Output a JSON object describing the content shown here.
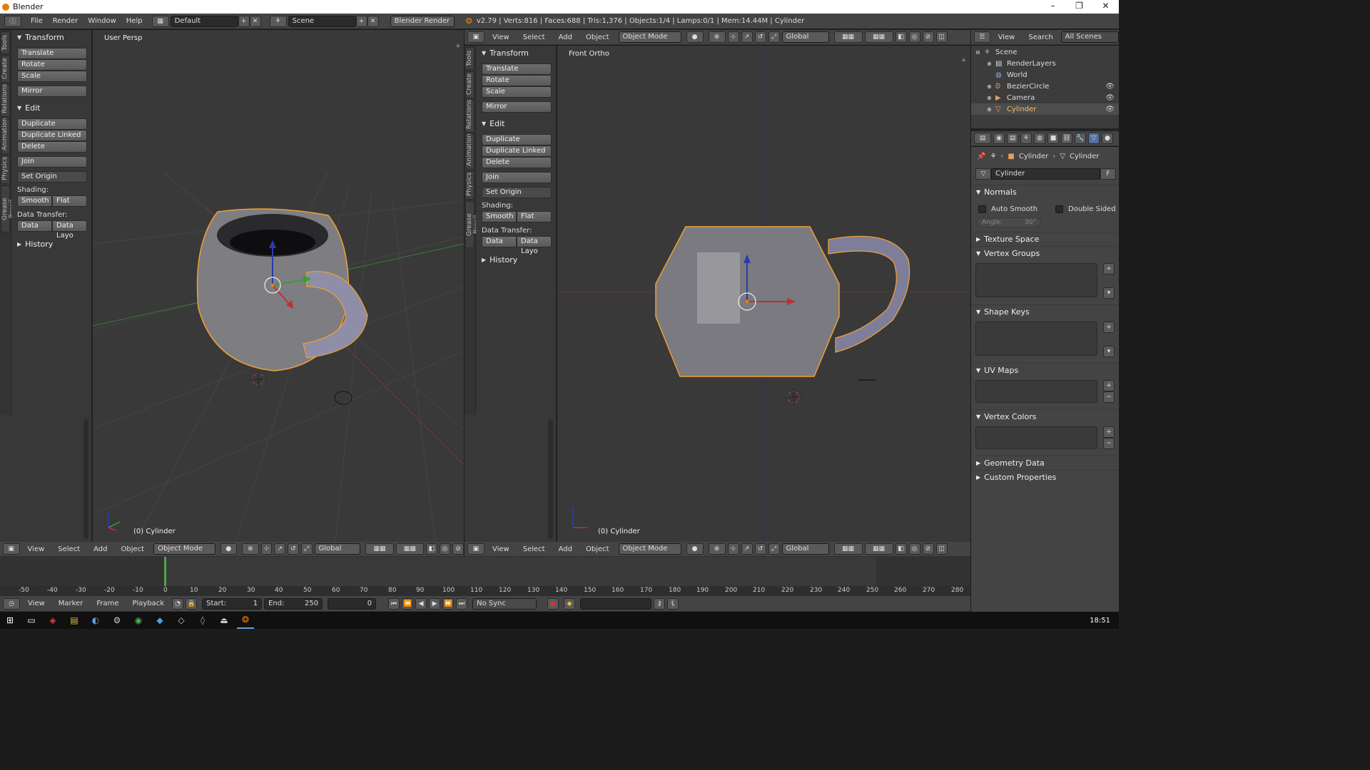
{
  "window": {
    "title": "Blender",
    "min": "–",
    "restore": "❐",
    "close": "✕"
  },
  "info": {
    "menus": [
      "File",
      "Render",
      "Window",
      "Help"
    ],
    "layout": "Default",
    "scene": "Scene",
    "engine": "Blender Render",
    "stats": "v2.79 | Verts:816 | Faces:688 | Tris:1,376 | Objects:1/4 | Lamps:0/1 | Mem:14.44M | Cylinder"
  },
  "toolshelf": {
    "tabs": [
      "Tools",
      "Create",
      "Relations",
      "Animation",
      "Physics",
      "Grease Pencil"
    ],
    "transform_title": "Transform",
    "translate": "Translate",
    "rotate": "Rotate",
    "scale": "Scale",
    "mirror": "Mirror",
    "edit_title": "Edit",
    "duplicate": "Duplicate",
    "duplicate_linked": "Duplicate Linked",
    "delete": "Delete",
    "join": "Join",
    "set_origin": "Set Origin",
    "shading_label": "Shading:",
    "smooth": "Smooth",
    "flat": "Flat",
    "data_transfer_label": "Data Transfer:",
    "data": "Data",
    "data_layo": "Data Layo",
    "history": "History"
  },
  "viewport_left": {
    "label": "User Persp",
    "object": "(0) Cylinder"
  },
  "viewport_right": {
    "label": "Front Ortho",
    "object": "(0) Cylinder"
  },
  "view_header": {
    "menus": [
      "View",
      "Select",
      "Add",
      "Object"
    ],
    "mode": "Object Mode",
    "orientation": "Global"
  },
  "outliner": {
    "menus": [
      "View",
      "Search"
    ],
    "filter": "All Scenes",
    "items": [
      {
        "name": "Scene",
        "color": "#ddd"
      },
      {
        "name": "RenderLayers",
        "color": "#ddd"
      },
      {
        "name": "World",
        "color": "#ddd"
      },
      {
        "name": "BezierCircle",
        "color": "#ddd"
      },
      {
        "name": "Camera",
        "color": "#ddd"
      },
      {
        "name": "Cylinder",
        "color": "#f0c070"
      }
    ]
  },
  "properties": {
    "breadcrumb_obj": "Cylinder",
    "breadcrumb_mesh": "Cylinder",
    "mesh_name": "Cylinder",
    "fake_user": "F",
    "normals": "Normals",
    "auto_smooth": "Auto Smooth",
    "double_sided": "Double Sided",
    "angle_label": "Angle:",
    "angle_value": "30°",
    "texture_space": "Texture Space",
    "vertex_groups": "Vertex Groups",
    "shape_keys": "Shape Keys",
    "uv_maps": "UV Maps",
    "vertex_colors": "Vertex Colors",
    "geometry_data": "Geometry Data",
    "custom_properties": "Custom Properties"
  },
  "timeline": {
    "ticks": [
      "-50",
      "-40",
      "-30",
      "-20",
      "-10",
      "0",
      "10",
      "20",
      "30",
      "40",
      "50",
      "60",
      "70",
      "80",
      "90",
      "100",
      "110",
      "120",
      "130",
      "140",
      "150",
      "160",
      "170",
      "180",
      "190",
      "200",
      "210",
      "220",
      "230",
      "240",
      "250",
      "260",
      "270",
      "280"
    ],
    "menus": [
      "View",
      "Marker",
      "Frame",
      "Playback"
    ],
    "start": "Start:",
    "start_value": "1",
    "end": "End:",
    "end_value": "250",
    "current": "0",
    "sync": "No Sync"
  },
  "taskbar": {
    "clock": "18:51"
  },
  "colors": {
    "accent": "#e87d0d",
    "selected_outline": "#f0a030",
    "axis_x": "#b03030",
    "axis_y": "#3a8a3a",
    "axis_z": "#2a3ab0"
  }
}
